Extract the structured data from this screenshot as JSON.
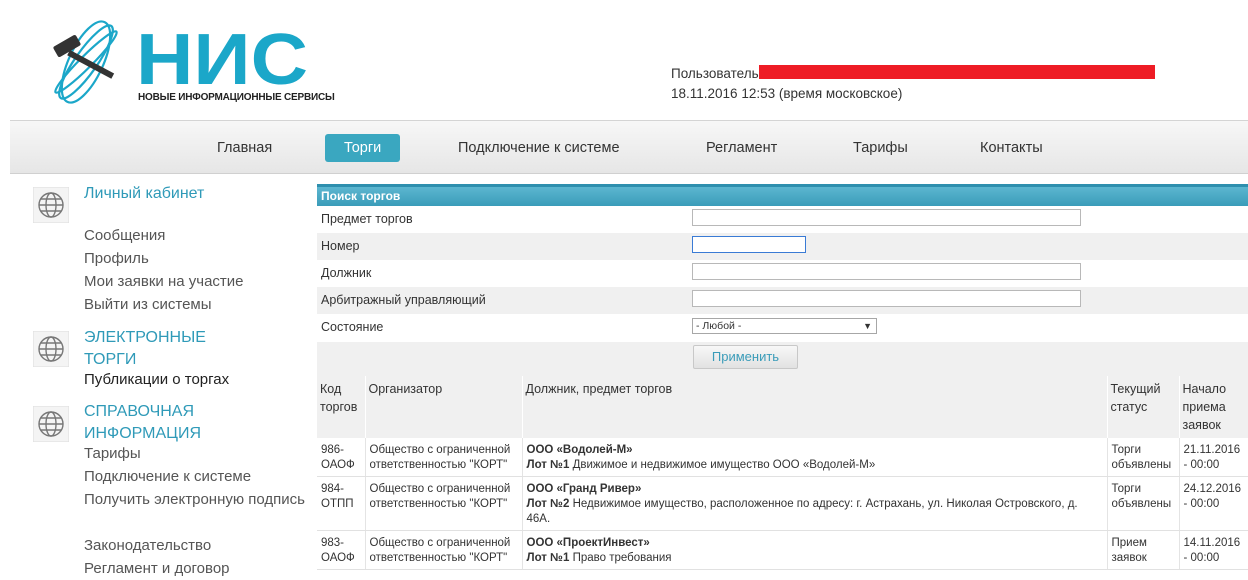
{
  "header": {
    "logo_text": "НИС",
    "logo_subtitle": "НОВЫЕ ИНФОРМАЦИОННЫЕ СЕРВИСЫ",
    "user_label": "Пользователь",
    "datetime": "18.11.2016 12:53 (время московское)"
  },
  "nav": {
    "items": [
      "Главная",
      "Торги",
      "Подключение к системе",
      "Регламент",
      "Тарифы",
      "Контакты"
    ],
    "active": "Торги"
  },
  "sidebar": {
    "groups": [
      {
        "title": "Личный кабинет",
        "links": [
          "Сообщения",
          "Профиль",
          "Мои заявки на участие",
          "Выйти из системы"
        ]
      },
      {
        "title": "ЭЛЕКТРОННЫЕ ТОРГИ",
        "links": [
          "Публикации о торгах"
        ]
      },
      {
        "title": "СПРАВОЧНАЯ ИНФОРМАЦИЯ",
        "links": [
          "Тарифы",
          "Подключение к системе",
          "Получить электронную подпись",
          "Законодательство",
          "Регламент и договор"
        ]
      }
    ]
  },
  "search": {
    "title": "Поиск торгов",
    "fields": {
      "subject": "Предмет торгов",
      "number": "Номер",
      "debtor": "Должник",
      "manager": "Арбитражный управляющий",
      "state": "Состояние"
    },
    "state_value": "- Любой -",
    "apply": "Применить"
  },
  "results": {
    "columns": [
      "Код торгов",
      "Организатор",
      "Должник, предмет торгов",
      "Текущий статус",
      "Начало приема заявок"
    ],
    "rows": [
      {
        "code": "986-ОАОФ",
        "org": "Общество с ограниченной ответственностью \"КОРТ\"",
        "debtor": "ООО «Водолей-М»",
        "lot": "Лот №1",
        "subject": "Движимое и недвижимое имущество ООО «Водолей-М»",
        "status": "Торги объявлены",
        "start": "21.11.2016 - 00:00"
      },
      {
        "code": "984-ОТПП",
        "org": "Общество с ограниченной ответственностью \"КОРТ\"",
        "debtor": "ООО «Гранд Ривер»",
        "lot": "Лот №2",
        "subject": "Недвижимое имущество, расположенное по адресу: г. Астрахань, ул. Николая Островского, д. 46А.",
        "status": "Торги объявлены",
        "start": "24.12.2016 - 00:00"
      },
      {
        "code": "983-ОАОФ",
        "org": "Общество с ограниченной ответственностью \"КОРТ\"",
        "debtor": "ООО «ПроектИнвест»",
        "lot": "Лот №1",
        "subject": "Право требования",
        "status": "Прием заявок",
        "start": "14.11.2016 - 00:00"
      }
    ]
  },
  "colors": {
    "accent": "#3aa7c0",
    "logo": "#1ba7c9",
    "redaction": "#ee1c25"
  }
}
